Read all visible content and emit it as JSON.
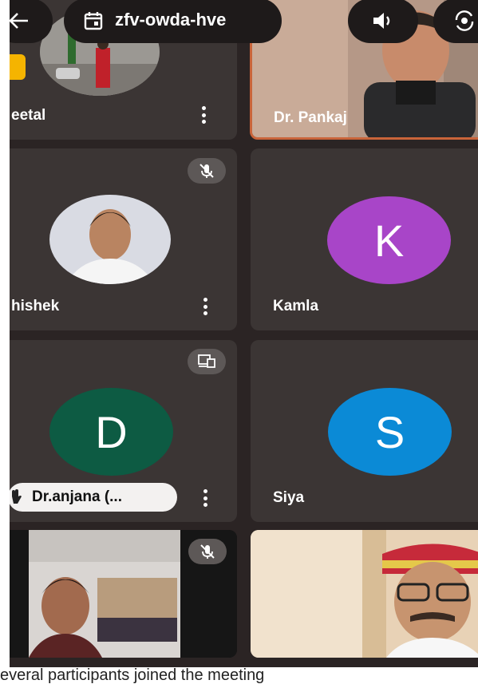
{
  "meeting": {
    "code": "zfv-owda-hve"
  },
  "icons": {
    "back": "arrow-left-icon",
    "calendar": "calendar-icon",
    "speaker": "speaker-icon",
    "camera_switch": "camera-switch-icon"
  },
  "participants": [
    {
      "name": "eetal"
    },
    {
      "name": "Dr. Pankaj"
    },
    {
      "name": "hishek"
    },
    {
      "name": "Kamla",
      "initial": "K"
    },
    {
      "name": "Dr.anjana (...",
      "initial": "D"
    },
    {
      "name": "Siya",
      "initial": "S"
    }
  ],
  "colors": {
    "background": "#2b2424",
    "tile": "#3b3534",
    "kamla_avatar": "#a845c8",
    "anjana_avatar": "#0d5b43",
    "siya_avatar": "#0b8ad6",
    "active_speaker_border": "#c9643a"
  },
  "caption": "everal participants joined the meeting"
}
